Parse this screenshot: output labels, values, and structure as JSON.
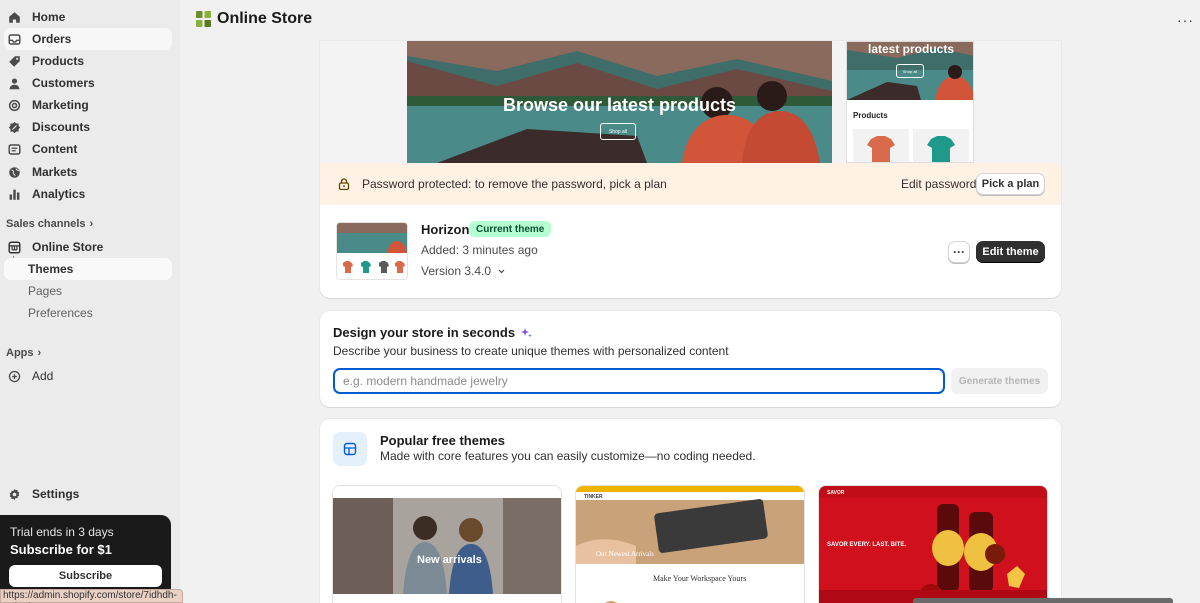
{
  "sidebar": {
    "items": [
      {
        "label": "Home",
        "icon": "home-icon"
      },
      {
        "label": "Orders",
        "icon": "inbox-icon"
      },
      {
        "label": "Products",
        "icon": "tag-icon"
      },
      {
        "label": "Customers",
        "icon": "person-icon"
      },
      {
        "label": "Marketing",
        "icon": "target-icon"
      },
      {
        "label": "Discounts",
        "icon": "discount-icon"
      },
      {
        "label": "Content",
        "icon": "content-icon"
      },
      {
        "label": "Markets",
        "icon": "globe-icon"
      },
      {
        "label": "Analytics",
        "icon": "bar-chart-icon"
      }
    ],
    "sales_channels_label": "Sales channels",
    "online_store_label": "Online Store",
    "sub_items": [
      "Themes",
      "Pages",
      "Preferences"
    ],
    "apps_label": "Apps",
    "add_label": "Add",
    "settings_label": "Settings"
  },
  "trial": {
    "line1": "Trial ends in 3 days",
    "line2": "Subscribe for $1",
    "button": "Subscribe"
  },
  "status_url": "https://admin.shopify.com/store/7idhdh-xn/orders",
  "header": {
    "title": "Online Store",
    "more": "···"
  },
  "hero": {
    "desktop_headline": "Browse our latest products",
    "desktop_button": "Shop all",
    "mobile_headline": "latest products",
    "mobile_button": "Shop all",
    "mobile_products_title": "Products"
  },
  "password_banner": {
    "message": "Password protected: to remove the password, pick a plan",
    "edit_password": "Edit password",
    "pick_plan": "Pick a plan"
  },
  "current_theme": {
    "name": "Horizon",
    "badge": "Current theme",
    "added": "Added: 3 minutes ago",
    "version": "Version 3.4.0",
    "more": "···",
    "edit_button": "Edit theme"
  },
  "design": {
    "title": "Design your store in seconds",
    "description": "Describe your business to create unique themes with personalized content",
    "placeholder": "e.g. modern handmade jewelry",
    "button": "Generate themes"
  },
  "popular": {
    "title": "Popular free themes",
    "description": "Made with core features you can easily customize—no coding needed.",
    "cards": [
      {
        "caption": "New arrivals"
      },
      {
        "brand": "TINKER",
        "caption": "Our Newest Arrivals",
        "sub": "Make Your Workspace Yours"
      },
      {
        "brand": "SAVOR",
        "caption": "SAVOR EVERY. LAST. BITE."
      }
    ]
  },
  "colors": {
    "accent_blue": "#005bd3",
    "badge_green": "#b4fed2",
    "banner_bg": "#fff1e3",
    "primary_button": "#303030"
  }
}
